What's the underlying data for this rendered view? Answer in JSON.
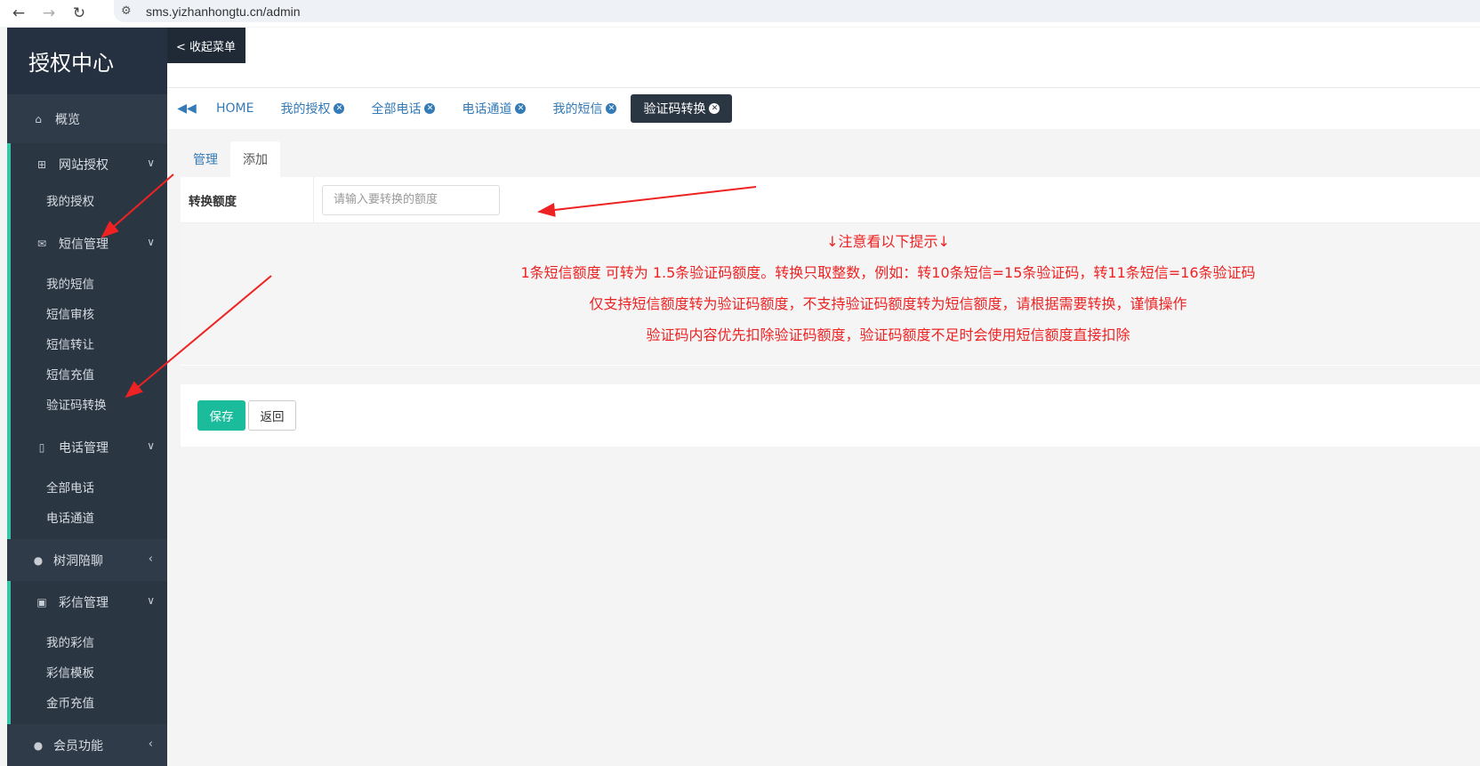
{
  "browser": {
    "url": "sms.yizhanhongtu.cn/admin",
    "back_icon": "←",
    "forward_icon": "→",
    "reload_icon": "↻",
    "site_info_icon": "⚙"
  },
  "sidebar": {
    "logo": "授权中心",
    "overview": {
      "label": "概览",
      "icon": "home-icon"
    },
    "groups": [
      {
        "label": "网站授权",
        "icon": "sitemap-icon",
        "items": [
          "我的授权"
        ]
      },
      {
        "label": "短信管理",
        "icon": "envelope-icon",
        "items": [
          "我的短信",
          "短信审核",
          "短信转让",
          "短信充值",
          "验证码转换"
        ]
      },
      {
        "label": "电话管理",
        "icon": "mobile-icon",
        "items": [
          "全部电话",
          "电话通道"
        ]
      }
    ],
    "chat": {
      "label": "树洞陪聊",
      "icon": "wechat-icon"
    },
    "mms": {
      "label": "彩信管理",
      "icon": "sim-card-icon",
      "items": [
        "我的彩信",
        "彩信模板",
        "金币充值"
      ]
    },
    "member": {
      "label": "会员功能",
      "icon": "user-icon"
    }
  },
  "header": {
    "collapse_label": "< 收起菜单"
  },
  "tabs": {
    "home": "HOME",
    "items": [
      "我的授权",
      "全部电话",
      "电话通道",
      "我的短信",
      "验证码转换"
    ],
    "active": "验证码转换"
  },
  "subtabs": {
    "manage": "管理",
    "add": "添加"
  },
  "form": {
    "label": "转换额度",
    "placeholder": "请输入要转换的额度",
    "value": ""
  },
  "notice": {
    "lines": [
      "↓注意看以下提示↓",
      "1条短信额度 可转为 1.5条验证码额度。转换只取整数，例如：转10条短信=15条验证码，转11条短信=16条验证码",
      "仅支持短信额度转为验证码额度，不支持验证码额度转为短信额度，请根据需要转换，谨慎操作",
      "验证码内容优先扣除验证码额度，验证码额度不足时会使用短信额度直接扣除"
    ],
    "color": "#ee2222"
  },
  "actions": {
    "save": "保存",
    "back": "返回"
  },
  "colors": {
    "sidebar_bg": "#2b3643",
    "accent_green": "#1bbc9b",
    "link_blue": "#337ab7",
    "annotation_red": "#ee2222"
  }
}
